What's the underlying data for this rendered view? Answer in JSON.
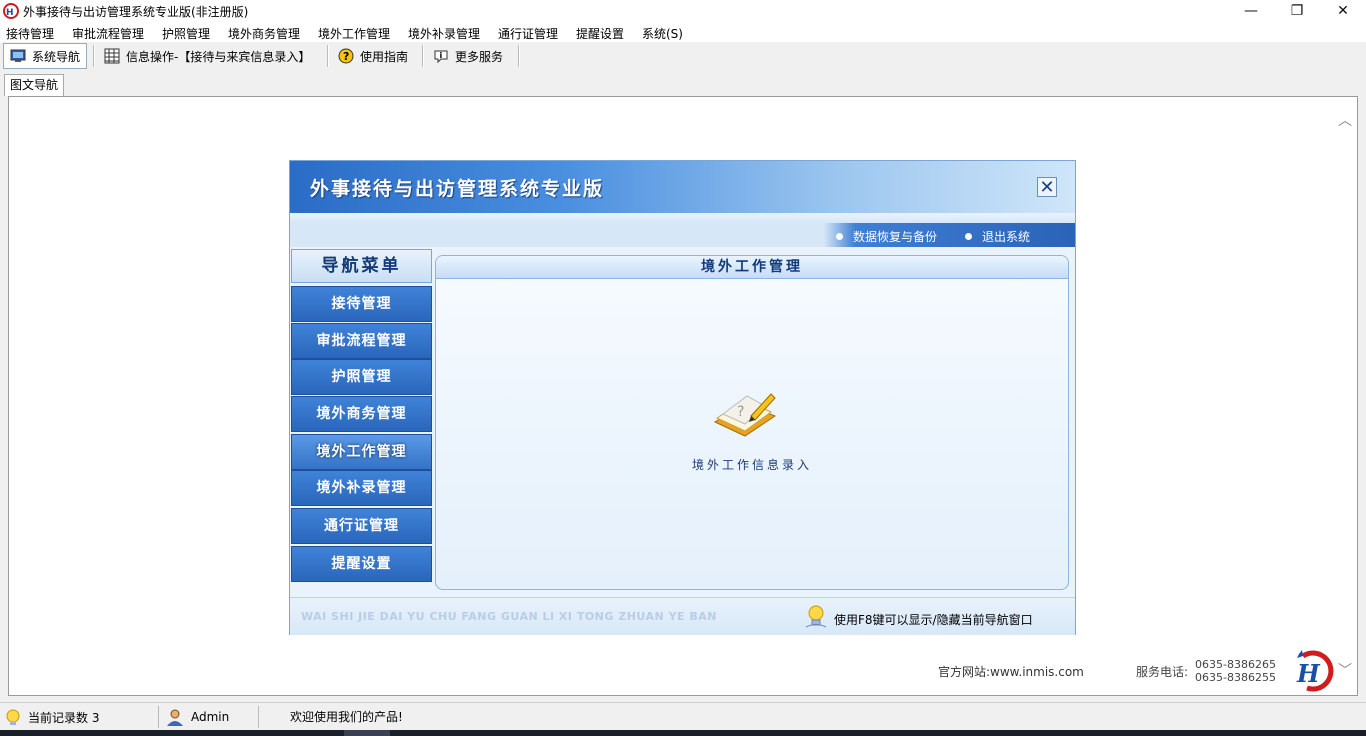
{
  "window": {
    "title": "外事接待与出访管理系统专业版(非注册版)",
    "minimize": "—",
    "maximize": "❐",
    "close": "✕"
  },
  "menu": [
    "接待管理",
    "审批流程管理",
    "护照管理",
    "境外商务管理",
    "境外工作管理",
    "境外补录管理",
    "通行证管理",
    "提醒设置",
    "系统(S)"
  ],
  "toolbar": {
    "nav": "系统导航",
    "info": "信息操作-【接待与来宾信息录入】",
    "guide": "使用指南",
    "more": "更多服务"
  },
  "tabs": {
    "active": "图文导航"
  },
  "dialog": {
    "title": "外事接待与出访管理系统专业版",
    "close": "✕",
    "links": [
      "数据恢复与备份",
      "退出系统"
    ],
    "nav_title": "导航菜单",
    "nav_items": [
      "接待管理",
      "审批流程管理",
      "护照管理",
      "境外商务管理",
      "境外工作管理",
      "境外补录管理",
      "通行证管理",
      "提醒设置"
    ],
    "selected_nav": "境外工作管理",
    "panel_title": "境外工作管理",
    "task_label": "境外工作信息录入",
    "pinyin": "WAI SHI JIE DAI YU CHU FANG GUAN LI XI TONG ZHUAN YE BAN",
    "hint": "使用F8键可以显示/隐藏当前导航窗口"
  },
  "footer_info": {
    "site": "官方网站:www.inmis.com",
    "phone_label": "服务电话:",
    "phones": [
      "0635-8386265",
      "0635-8386255"
    ]
  },
  "status": {
    "records": "当前记录数 3",
    "user": "Admin",
    "welcome": "欢迎使用我们的产品!"
  },
  "colors": {
    "dialog_blue": "#2a66bb",
    "header_gradient_start": "#2a6cc6",
    "panel_title": "#123a78"
  }
}
